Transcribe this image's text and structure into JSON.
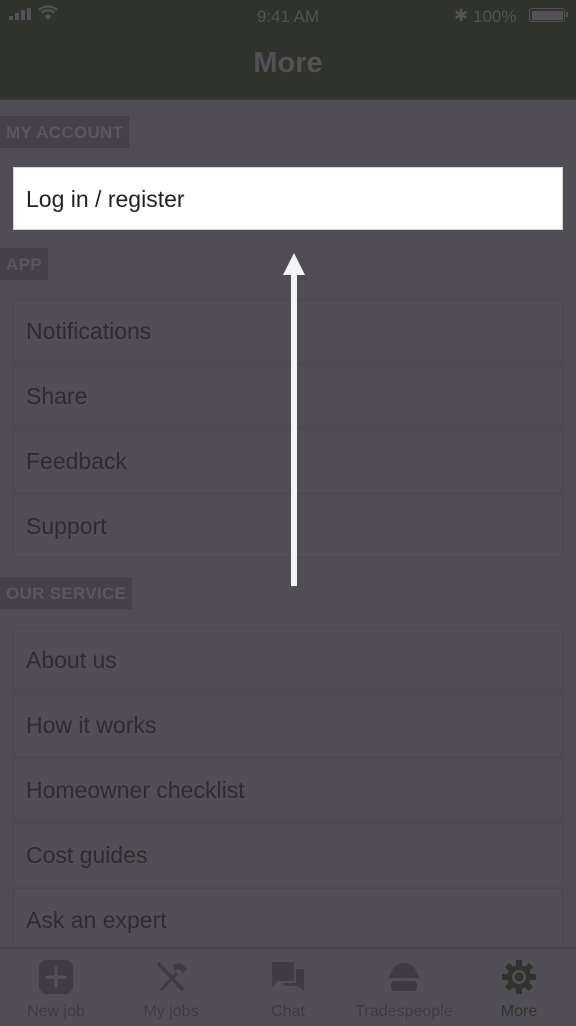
{
  "status_bar": {
    "time": "9:41 AM",
    "battery": "100%"
  },
  "navbar": {
    "title": "More"
  },
  "sections": [
    {
      "label": "MY ACCOUNT",
      "items": [
        {
          "label": "Log in / register"
        }
      ]
    },
    {
      "label": "APP",
      "items": [
        {
          "label": "Notifications"
        },
        {
          "label": "Share"
        },
        {
          "label": "Feedback"
        },
        {
          "label": "Support"
        }
      ]
    },
    {
      "label": "OUR SERVICE",
      "items": [
        {
          "label": "About us"
        },
        {
          "label": "How it works"
        },
        {
          "label": "Homeowner checklist"
        },
        {
          "label": "Cost guides"
        },
        {
          "label": "Ask an expert"
        }
      ]
    }
  ],
  "tabbar": {
    "tabs": [
      {
        "label": "New job",
        "icon": "plus-square-icon"
      },
      {
        "label": "My jobs",
        "icon": "tools-icon"
      },
      {
        "label": "Chat",
        "icon": "chat-icon"
      },
      {
        "label": "Tradespeople",
        "icon": "hardhat-icon"
      },
      {
        "label": "More",
        "icon": "gear-icon",
        "active": true
      }
    ]
  },
  "colors": {
    "header": "#2e342c",
    "overlay_bg": "#514d54",
    "highlight": "#ffffff",
    "arrow": "#f4f4f4"
  }
}
